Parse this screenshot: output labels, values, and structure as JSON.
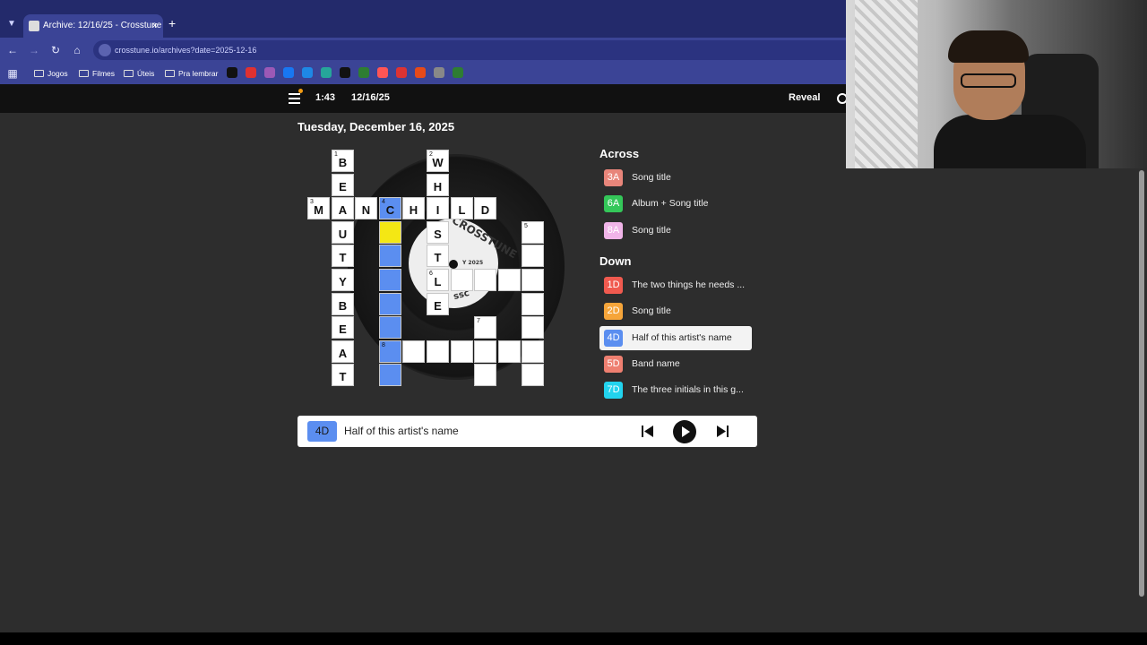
{
  "browser": {
    "tab_title": "Archive: 12/16/25 - Crosstune",
    "tab_close": "×",
    "new_tab": "+",
    "url": "crosstune.io/archives?date=2025-12-16",
    "bookmarks": [
      "Jogos",
      "Filmes",
      "Úteis",
      "Pra lembrar"
    ],
    "bookmark_icon_colors": [
      "#111111",
      "#e03131",
      "#9b59b6",
      "#1877f2",
      "#1e88e5",
      "#26a69a",
      "#111111",
      "#2e7d32",
      "#ff5555",
      "#d33",
      "#e64a19",
      "#888888",
      "#2e7d32"
    ]
  },
  "header": {
    "timer": "1:43",
    "date": "12/16/25",
    "reveal": "Reveal"
  },
  "page": {
    "title": "Tuesday, December 16, 2025"
  },
  "vinyl": {
    "label_text": "CROSSTUNE",
    "label_year": "Y 2025",
    "label_small": "ssc"
  },
  "grid": {
    "cells": [
      {
        "row": 0,
        "col": 1,
        "num": "1",
        "letter": "B",
        "state": "normal"
      },
      {
        "row": 0,
        "col": 5,
        "num": "2",
        "letter": "W",
        "state": "normal"
      },
      {
        "row": 1,
        "col": 1,
        "num": "",
        "letter": "E",
        "state": "normal"
      },
      {
        "row": 1,
        "col": 5,
        "num": "",
        "letter": "H",
        "state": "normal"
      },
      {
        "row": 2,
        "col": 0,
        "num": "3",
        "letter": "M",
        "state": "normal"
      },
      {
        "row": 2,
        "col": 1,
        "num": "",
        "letter": "A",
        "state": "normal"
      },
      {
        "row": 2,
        "col": 2,
        "num": "",
        "letter": "N",
        "state": "normal"
      },
      {
        "row": 2,
        "col": 3,
        "num": "4",
        "letter": "C",
        "state": "hl"
      },
      {
        "row": 2,
        "col": 4,
        "num": "",
        "letter": "H",
        "state": "normal"
      },
      {
        "row": 2,
        "col": 5,
        "num": "",
        "letter": "I",
        "state": "normal"
      },
      {
        "row": 2,
        "col": 6,
        "num": "",
        "letter": "L",
        "state": "normal"
      },
      {
        "row": 2,
        "col": 7,
        "num": "",
        "letter": "D",
        "state": "normal"
      },
      {
        "row": 3,
        "col": 1,
        "num": "",
        "letter": "U",
        "state": "normal"
      },
      {
        "row": 3,
        "col": 3,
        "num": "",
        "letter": "",
        "state": "cur"
      },
      {
        "row": 3,
        "col": 5,
        "num": "",
        "letter": "S",
        "state": "normal"
      },
      {
        "row": 3,
        "col": 9,
        "num": "5",
        "letter": "",
        "state": "normal"
      },
      {
        "row": 4,
        "col": 1,
        "num": "",
        "letter": "T",
        "state": "normal"
      },
      {
        "row": 4,
        "col": 3,
        "num": "",
        "letter": "",
        "state": "hl"
      },
      {
        "row": 4,
        "col": 5,
        "num": "",
        "letter": "T",
        "state": "normal"
      },
      {
        "row": 4,
        "col": 9,
        "num": "",
        "letter": "",
        "state": "normal"
      },
      {
        "row": 5,
        "col": 1,
        "num": "",
        "letter": "Y",
        "state": "normal"
      },
      {
        "row": 5,
        "col": 3,
        "num": "",
        "letter": "",
        "state": "hl"
      },
      {
        "row": 5,
        "col": 5,
        "num": "6",
        "letter": "L",
        "state": "normal"
      },
      {
        "row": 5,
        "col": 6,
        "num": "",
        "letter": "",
        "state": "normal"
      },
      {
        "row": 5,
        "col": 7,
        "num": "",
        "letter": "",
        "state": "normal"
      },
      {
        "row": 5,
        "col": 8,
        "num": "",
        "letter": "",
        "state": "normal"
      },
      {
        "row": 5,
        "col": 9,
        "num": "",
        "letter": "",
        "state": "normal"
      },
      {
        "row": 6,
        "col": 1,
        "num": "",
        "letter": "B",
        "state": "normal"
      },
      {
        "row": 6,
        "col": 3,
        "num": "",
        "letter": "",
        "state": "hl"
      },
      {
        "row": 6,
        "col": 5,
        "num": "",
        "letter": "E",
        "state": "normal"
      },
      {
        "row": 6,
        "col": 9,
        "num": "",
        "letter": "",
        "state": "normal"
      },
      {
        "row": 7,
        "col": 1,
        "num": "",
        "letter": "E",
        "state": "normal"
      },
      {
        "row": 7,
        "col": 3,
        "num": "",
        "letter": "",
        "state": "hl"
      },
      {
        "row": 7,
        "col": 7,
        "num": "7",
        "letter": "",
        "state": "normal"
      },
      {
        "row": 7,
        "col": 9,
        "num": "",
        "letter": "",
        "state": "normal"
      },
      {
        "row": 8,
        "col": 1,
        "num": "",
        "letter": "A",
        "state": "normal"
      },
      {
        "row": 8,
        "col": 3,
        "num": "8",
        "letter": "",
        "state": "hl"
      },
      {
        "row": 8,
        "col": 4,
        "num": "",
        "letter": "",
        "state": "normal"
      },
      {
        "row": 8,
        "col": 5,
        "num": "",
        "letter": "",
        "state": "normal"
      },
      {
        "row": 8,
        "col": 6,
        "num": "",
        "letter": "",
        "state": "normal"
      },
      {
        "row": 8,
        "col": 7,
        "num": "",
        "letter": "",
        "state": "normal"
      },
      {
        "row": 8,
        "col": 8,
        "num": "",
        "letter": "",
        "state": "normal"
      },
      {
        "row": 8,
        "col": 9,
        "num": "",
        "letter": "",
        "state": "normal"
      },
      {
        "row": 9,
        "col": 1,
        "num": "",
        "letter": "T",
        "state": "normal"
      },
      {
        "row": 9,
        "col": 3,
        "num": "",
        "letter": "",
        "state": "hl"
      },
      {
        "row": 9,
        "col": 7,
        "num": "",
        "letter": "",
        "state": "normal"
      },
      {
        "row": 9,
        "col": 9,
        "num": "",
        "letter": "",
        "state": "normal"
      }
    ]
  },
  "clues": {
    "across_label": "Across",
    "down_label": "Down",
    "across": [
      {
        "id": "3A",
        "text": "Song title",
        "color": "#e8857a",
        "active": false
      },
      {
        "id": "6A",
        "text": "Album + Song title",
        "color": "#34c759",
        "active": false
      },
      {
        "id": "8A",
        "text": "Song title",
        "color": "#f0b4e8",
        "active": false
      }
    ],
    "down": [
      {
        "id": "1D",
        "text": "The two things he needs ...",
        "color": "#f05a4f",
        "active": false
      },
      {
        "id": "2D",
        "text": "Song title",
        "color": "#f6a53a",
        "active": false
      },
      {
        "id": "4D",
        "text": "Half of this artist's name",
        "color": "#5b8ef0",
        "active": true
      },
      {
        "id": "5D",
        "text": "Band name",
        "color": "#ee7f70",
        "active": false
      },
      {
        "id": "7D",
        "text": "The three initials in this g...",
        "color": "#22d3ee",
        "active": false
      }
    ]
  },
  "player": {
    "clue_id": "4D",
    "clue_text": "Half of this artist's name"
  }
}
